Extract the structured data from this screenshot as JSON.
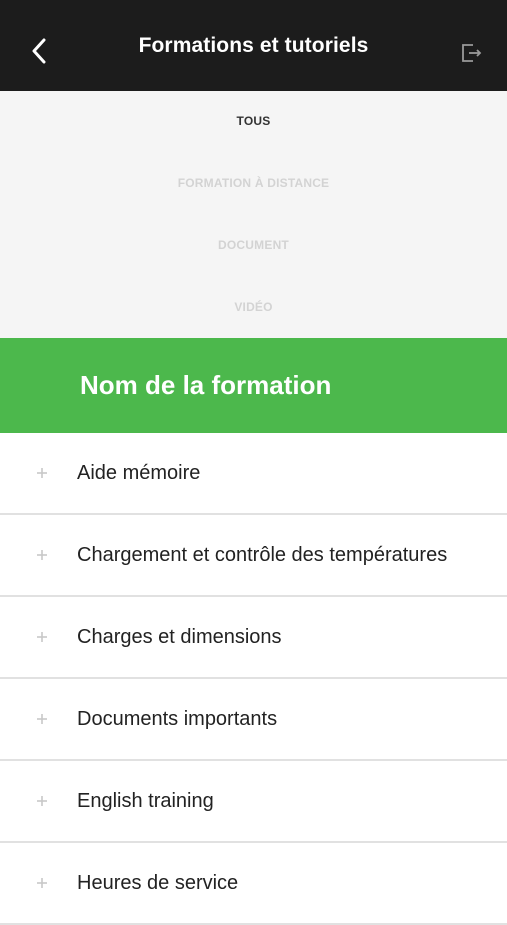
{
  "header": {
    "title": "Formations et tutoriels",
    "back_icon": "chevron-left-icon",
    "logout_icon": "logout-icon"
  },
  "filters": [
    {
      "label": "TOUS",
      "active": true
    },
    {
      "label": "FORMATION À DISTANCE",
      "active": false
    },
    {
      "label": "DOCUMENT",
      "active": false
    },
    {
      "label": "VIDÉO",
      "active": false
    }
  ],
  "banner": {
    "title": "Nom de la formation"
  },
  "items": [
    {
      "label": "Aide mémoire",
      "icon": "plus-icon"
    },
    {
      "label": "Chargement et contrôle des températures",
      "icon": "plus-icon"
    },
    {
      "label": "Charges et dimensions",
      "icon": "plus-icon"
    },
    {
      "label": "Documents importants",
      "icon": "plus-icon"
    },
    {
      "label": "English training",
      "icon": "plus-icon"
    },
    {
      "label": "Heures de service",
      "icon": "plus-icon"
    }
  ],
  "colors": {
    "header_bg": "#1c1c1c",
    "filters_bg": "#f5f5f5",
    "accent": "#4cb84c",
    "active_filter": "#333333",
    "inactive_filter": "#d3d3d3",
    "divider": "#e1e1e1"
  }
}
